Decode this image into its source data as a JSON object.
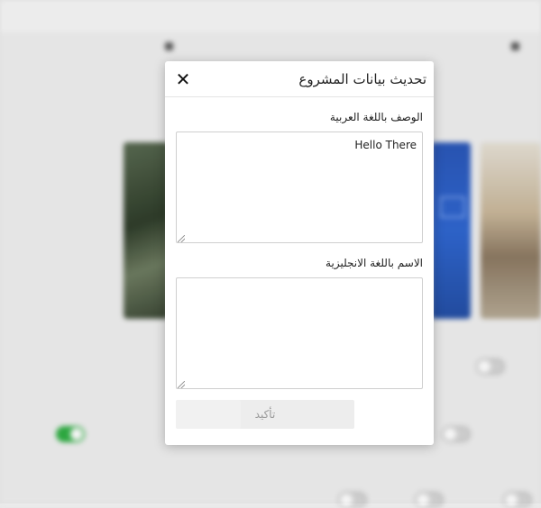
{
  "modal": {
    "title": "تحديث بيانات المشروع",
    "close_symbol": "✕",
    "fields": [
      {
        "label": "الوصف باللغة العربية",
        "value": "Hello There",
        "placeholder": ""
      },
      {
        "label": "الاسم باللغة الانجليزية",
        "value": "",
        "placeholder": ""
      }
    ],
    "submit_label": "تأكيد"
  },
  "icons": {
    "close": "close-icon",
    "resize": "resize-grip-icon"
  },
  "colors": {
    "toggle_on": "#2fae43",
    "image_blue": "#2f66d0"
  }
}
